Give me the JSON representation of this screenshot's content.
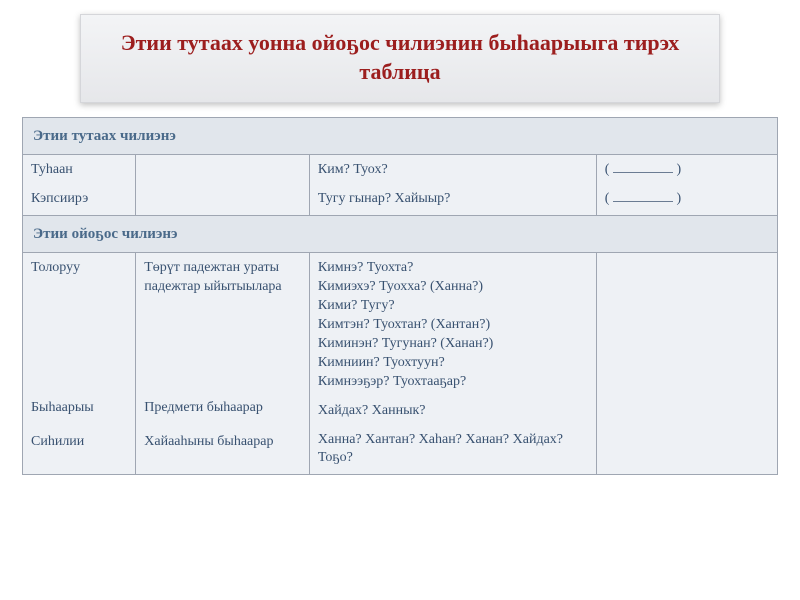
{
  "title": "Этии  тутаах  уонна  ойоҕос  чилиэнин  быһаарыыга тирэх  таблица",
  "section1": {
    "header": "Этии  тутаах  чилиэнэ",
    "row": {
      "c1a": "Туһаан",
      "c1b": "Кэпсиирэ",
      "c3a": "Ким?  Туох?",
      "c3b": "Тугу  гынар?  Хайыыр?",
      "c4a_open": "(",
      "c4a_close": ")",
      "c4b_open": "(",
      "c4b_close": ")"
    }
  },
  "section2": {
    "header": "Этии  ойоҕос  чилиэнэ",
    "row": {
      "c1a": "Толоруу",
      "c1b": "Быһаарыы",
      "c1c": "Сиһилии",
      "c2a": "Төрүт падежтан ураты падежтар ыйытыылара",
      "c2b": "Предмети  быһаарар",
      "c2c": "Хайааһыны быһаарар",
      "c3_l1": "Кимнэ? Туохта?",
      "c3_l2": "Кимиэхэ? Туохха? (Ханна?)",
      "c3_l3": "Кими? Тугу?",
      "c3_l4": "Кимтэн? Туохтан? (Хантан?)",
      "c3_l5": "Киминэн? Тугунан? (Ханан?)",
      "c3_l6": "Кимниин? Туохтуун?",
      "c3_l7": "Кимнээҕэр? Туохтааҕар?",
      "c3b": "Хайдах? Ханнык?",
      "c3c": "Ханна? Хантан? Хаһан? Ханан? Хайдах? Тоҕо?"
    }
  }
}
